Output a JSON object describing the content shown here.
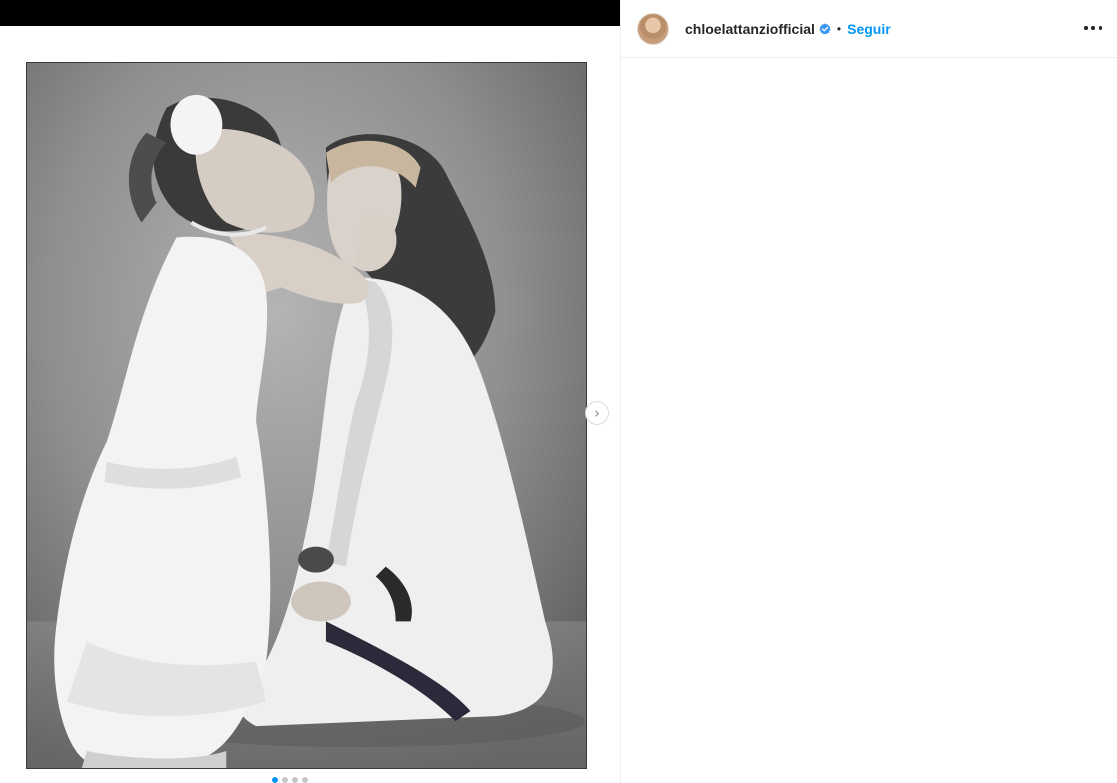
{
  "post": {
    "username": "chloelattanziofficial",
    "separator": "•",
    "follow_label": "Seguir",
    "more_icon": "more-horizontal-icon",
    "verified_icon": "verified-badge-icon",
    "verified_color": "#3897f0",
    "follow_color": "#0095f6"
  },
  "media": {
    "image_desc_icon": "photo",
    "next_icon": "chevron-right-icon",
    "next_glyph": "›",
    "carousel_dot_count": 4,
    "carousel_active_index": 0
  }
}
